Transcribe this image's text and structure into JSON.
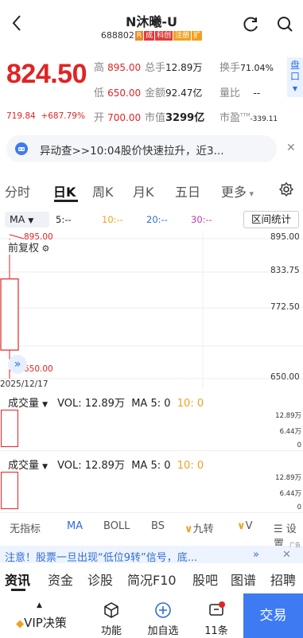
{
  "header": {
    "title": "N沐曦-U",
    "code": "688802",
    "tags": [
      {
        "text": "R",
        "color": "#f08a24"
      },
      {
        "text": "成",
        "color": "#e23a3a"
      },
      {
        "text": "科创",
        "color": "#e23a3a"
      },
      {
        "text": "注册",
        "color": "#f0a020"
      },
      {
        "text": "扩",
        "color": "#f0a020"
      }
    ]
  },
  "quote": {
    "price": "824.50",
    "prev_close": "719.84",
    "change_pct": "+687.79%",
    "high_label": "高",
    "high": "895.00",
    "low_label": "低",
    "low": "650.00",
    "open_label": "开",
    "open": "700.00",
    "volume_label": "总手",
    "volume": "12.89万",
    "amount_label": "金额",
    "amount": "92.47亿",
    "mktcap_label": "市值",
    "mktcap": "3299亿",
    "turnover_label": "换手",
    "turnover": "71.04%",
    "ratio_label": "量比",
    "ratio": "--",
    "pe_label": "市盈",
    "pe_sup": "TTM",
    "pe": "-339.11",
    "panel_label": "盘口"
  },
  "news": {
    "text": "异动查>>10:04股价快速拉升，近3..."
  },
  "tabs": [
    {
      "label": "分时",
      "active": false
    },
    {
      "label": "日K",
      "active": true
    },
    {
      "label": "周K",
      "active": false
    },
    {
      "label": "月K",
      "active": false
    },
    {
      "label": "五日",
      "active": false
    },
    {
      "label": "更多",
      "active": false
    }
  ],
  "ma_row": {
    "select": "MA",
    "ma5": "5:--",
    "ma10": "10:--",
    "ma20": "20:--",
    "ma30": "30:--",
    "range_stats": "区间统计"
  },
  "chart": {
    "fq_label": "前复权",
    "y_ticks": [
      "895.00",
      "833.75",
      "772.50",
      "650.00"
    ],
    "high_marker": "895.00",
    "low_marker": "650.00",
    "date": "2025/12/17"
  },
  "chart_data": {
    "type": "candlestick",
    "x": [
      "2025/12/17"
    ],
    "open": [
      700.0
    ],
    "high": [
      895.0
    ],
    "low": [
      650.0
    ],
    "close": [
      824.5
    ],
    "ylim": [
      650.0,
      895.0
    ],
    "y_ticks": [
      895.0,
      833.75,
      772.5,
      650.0
    ],
    "volume": [
      128900
    ]
  },
  "volume_panels": [
    {
      "select": "成交量",
      "vol_label": "VOL: 12.89万",
      "ma5": "MA 5: 0",
      "ma10": "10: 0",
      "ticks": [
        "12.89万",
        "6.44万",
        "0"
      ]
    },
    {
      "select": "成交量",
      "vol_label": "VOL: 12.89万",
      "ma5": "MA 5: 0",
      "ma10": "10: 0",
      "ticks": [
        "12.89万",
        "6.44万",
        "0"
      ]
    }
  ],
  "indicators": [
    "无指标",
    "MA",
    "BOLL",
    "BS",
    "九转",
    "V",
    "设置"
  ],
  "warning": {
    "text": "注意！股票一旦出现“低位9转”信号，底...",
    "ad": "广告"
  },
  "info_tabs": [
    "资讯",
    "资金",
    "诊股",
    "简况F10",
    "股吧",
    "图谱",
    "招聘"
  ],
  "bottom": {
    "vip": "VIP决策",
    "func": "功能",
    "watch": "加自选",
    "msgs": "11条",
    "trade": "交易"
  },
  "colors": {
    "up": "#e02424",
    "accent": "#3e7bf2",
    "ma10": "#f0a020",
    "ma20": "#2e6dd6",
    "ma30": "#c23ab0"
  }
}
